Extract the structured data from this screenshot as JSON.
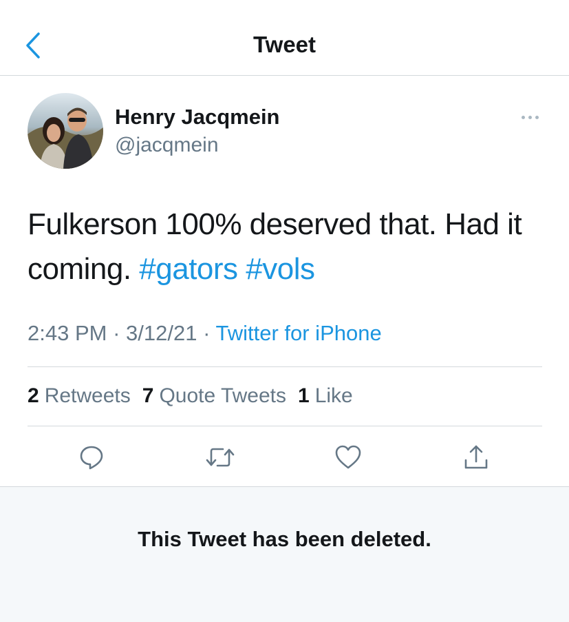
{
  "header": {
    "title": "Tweet",
    "back_icon": "chevron-left-icon"
  },
  "tweet": {
    "author": {
      "name": "Henry Jacqmein",
      "handle": "@jacqmein"
    },
    "text_plain": "Fulkerson 100% deserved that. Had it coming. ",
    "hashtags": [
      "#gators",
      "#vols"
    ],
    "time": "2:43 PM",
    "separator": "·",
    "date": "3/12/21",
    "source": "Twitter for iPhone",
    "stats": {
      "retweets_count": "2",
      "retweets_label": "Retweets",
      "quote_count": "7",
      "quote_label": "Quote Tweets",
      "likes_count": "1",
      "likes_label": "Like"
    },
    "actions": [
      "reply-icon",
      "retweet-icon",
      "like-icon",
      "share-icon"
    ]
  },
  "quoted": {
    "deleted_message": "This Tweet has been deleted."
  },
  "colors": {
    "accent": "#1b95e0",
    "text_primary": "#14171a",
    "text_secondary": "#657786",
    "divider": "#d3d8dc",
    "deleted_bg": "#f5f8fa"
  }
}
